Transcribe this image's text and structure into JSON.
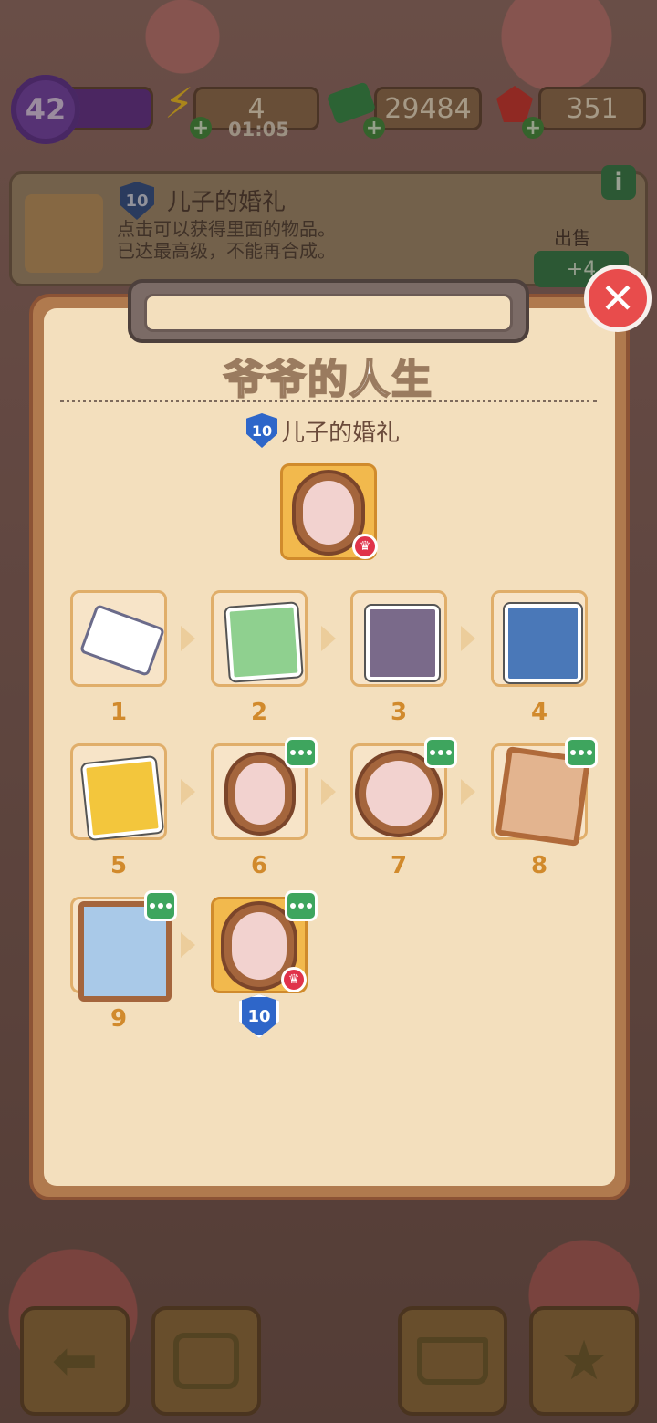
{
  "hud": {
    "level": "42",
    "energy": "4",
    "energy_timer": "01:05",
    "cash": "29484",
    "gems": "351"
  },
  "info": {
    "level_badge": "10",
    "title": "儿子的婚礼",
    "description": "点击可以获得里面的物品。\n已达最高级，不能再合成。",
    "sell_label": "出售",
    "sell_price": "+4"
  },
  "modal": {
    "title": "爷爷的人生",
    "item_level": "10",
    "item_name": "儿子的婚礼",
    "items": [
      {
        "number": "1"
      },
      {
        "number": "2"
      },
      {
        "number": "3"
      },
      {
        "number": "4"
      },
      {
        "number": "5"
      },
      {
        "number": "6"
      },
      {
        "number": "7"
      },
      {
        "number": "8"
      },
      {
        "number": "9"
      },
      {
        "number": "10"
      }
    ]
  },
  "colors": {
    "accent_orange": "#d18a2c",
    "panel": "#f3dfbd",
    "close_red": "#e84c4c",
    "badge_blue": "#2e66c9",
    "bubble_green": "#3ea55e"
  },
  "icons": {
    "level": "purple-star-badge",
    "energy": "lightning-icon",
    "cash": "cash-stack-icon",
    "gems": "ruby-icon",
    "close": "close-icon",
    "info": "info-icon",
    "bottom": [
      "back-arrow-icon",
      "backpack-icon",
      "basket-icon",
      "sticker-book-icon"
    ]
  }
}
